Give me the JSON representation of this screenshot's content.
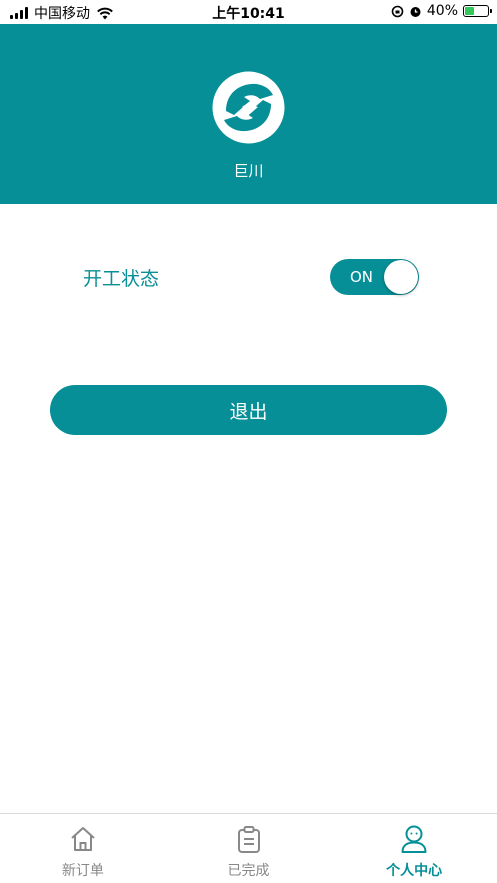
{
  "status_bar": {
    "carrier": "中国移动",
    "time": "上午10:41",
    "battery": "40%",
    "battery_level": 0.4
  },
  "header": {
    "logo_icon": "company-logo",
    "company_name": "巨川",
    "background_color": "#078f97"
  },
  "work_status": {
    "label": "开工状态",
    "toggle_text": "ON",
    "is_on": true
  },
  "logout_label": "退出",
  "tabs": [
    {
      "label": "新订单",
      "icon": "home-icon",
      "active": false
    },
    {
      "label": "已完成",
      "icon": "clipboard-icon",
      "active": false
    },
    {
      "label": "个人中心",
      "icon": "person-icon",
      "active": true
    }
  ],
  "colors": {
    "accent": "#078f97",
    "inactive_tab": "#888888"
  }
}
